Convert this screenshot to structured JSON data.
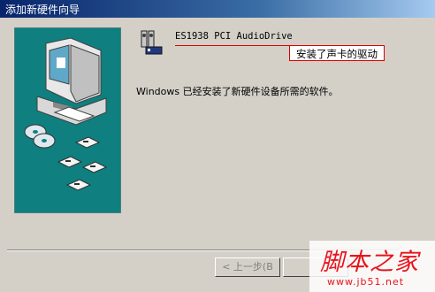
{
  "window": {
    "title": "添加新硬件向导"
  },
  "device": {
    "name": "ES1938 PCI AudioDrive",
    "icon": "speaker-device-icon"
  },
  "callout": {
    "text": "安装了声卡的驱动",
    "color": "#dd0000"
  },
  "message": "Windows 已经安装了新硬件设备所需的软件。",
  "buttons": {
    "back_label": "< 上一步(B"
  },
  "watermark": {
    "text": "脚本之家",
    "url": "www.jb51.net",
    "color": "#e8141c"
  },
  "colors": {
    "titlebar": "#08246b",
    "illustration_bg": "#0f7f7f",
    "window_bg": "#d4d0c8"
  }
}
